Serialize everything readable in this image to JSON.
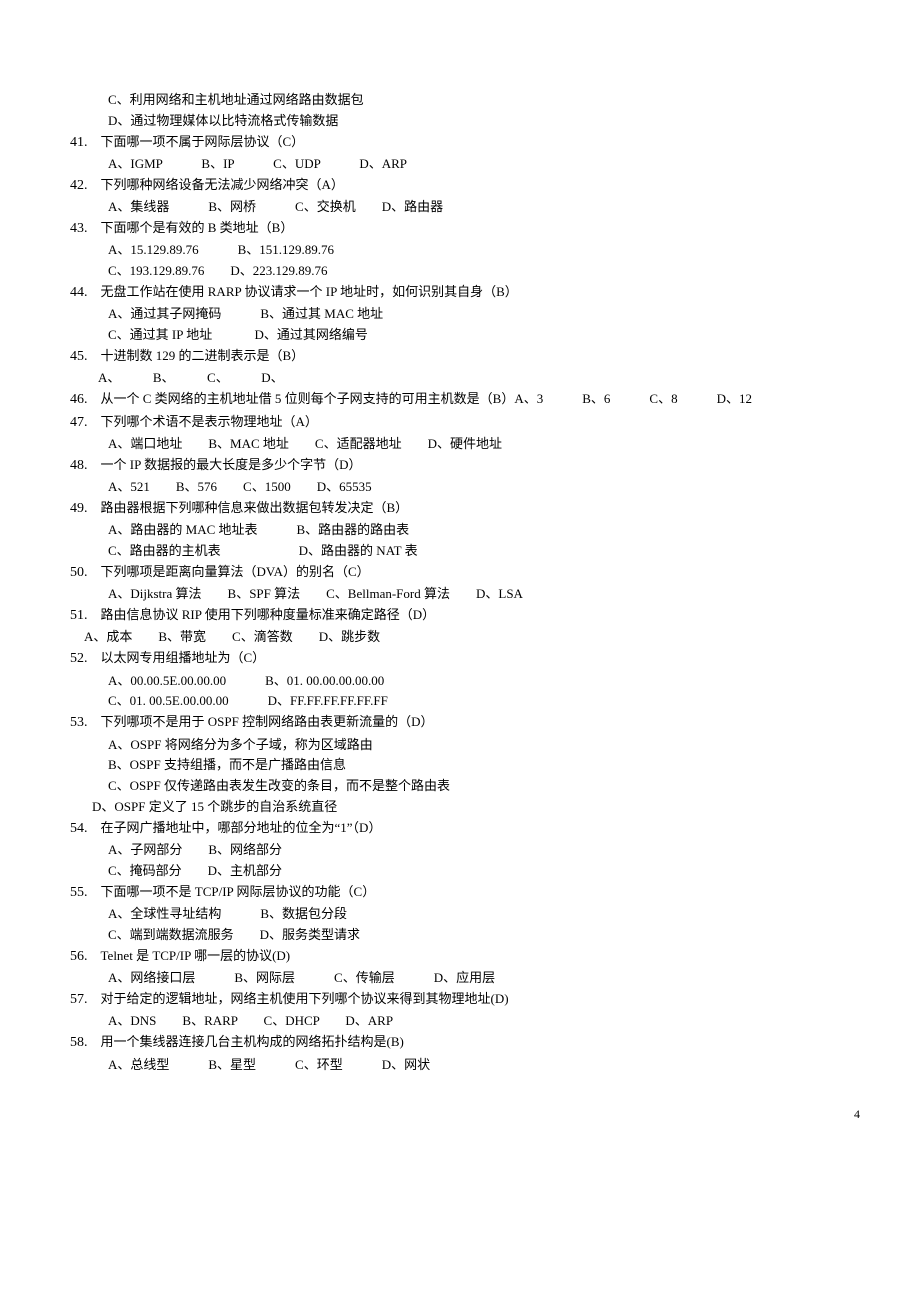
{
  "page_number": "4",
  "pre_options": {
    "c": "C、利用网络和主机地址通过网络路由数据包",
    "d": "D、通过物理媒体以比特流格式传输数据"
  },
  "q41": {
    "num": "41.",
    "text": "下面哪一项不属于网际层协议（C）",
    "opts": "A、IGMP　　　B、IP　　　C、UDP　　　D、ARP"
  },
  "q42": {
    "num": "42.",
    "text": "下列哪种网络设备无法减少网络冲突（A）",
    "opts": "A、集线器　　　B、网桥　　　C、交换机　　D、路由器"
  },
  "q43": {
    "num": "43.",
    "text": "下面哪个是有效的 B 类地址（B）",
    "line1": "A、15.129.89.76　　　B、151.129.89.76",
    "line2": "C、193.129.89.76　　D、223.129.89.76"
  },
  "q44": {
    "num": "44.",
    "text": "无盘工作站在使用 RARP 协议请求一个 IP 地址时，如何识别其自身（B）",
    "line1": "A、通过其子网掩码　　　B、通过其 MAC 地址",
    "line2": "C、通过其 IP 地址　　　 D、通过其网络编号"
  },
  "q45": {
    "num": "45.",
    "text": "十进制数 129 的二进制表示是（B）",
    "opts": "A、　　　B、　　　C、　　　D、"
  },
  "q46": {
    "num": "46.",
    "text": "从一个 C 类网络的主机地址借 5 位则每个子网支持的可用主机数是（B）A、3　　　B、6　　　C、8　　　D、12"
  },
  "q47": {
    "num": "47.",
    "text": "下列哪个术语不是表示物理地址（A）",
    "opts": "A、端口地址　　B、MAC 地址　　C、适配器地址　　D、硬件地址"
  },
  "q48": {
    "num": "48.",
    "text": "一个 IP 数据报的最大长度是多少个字节（D）",
    "opts": "A、521　　B、576　　C、1500　　D、65535"
  },
  "q49": {
    "num": "49.",
    "text": "路由器根据下列哪种信息来做出数据包转发决定（B）",
    "line1": "A、路由器的 MAC 地址表　　　B、路由器的路由表",
    "line2": "C、路由器的主机表　　　　　　D、路由器的 NAT 表"
  },
  "q50": {
    "num": "50.",
    "text": "下列哪项是距离向量算法（DVA）的别名（C）",
    "opts": "A、Dijkstra 算法　　B、SPF 算法　　C、Bellman-Ford 算法　　D、LSA"
  },
  "q51": {
    "num": "51.",
    "text": "路由信息协议 RIP 使用下列哪种度量标准来确定路径（D）",
    "opts": "A、成本　　B、带宽　　C、滴答数　　D、跳步数"
  },
  "q52": {
    "num": "52.",
    "text": "以太网专用组播地址为（C）",
    "line1": "A、00.00.5E.00.00.00　　　B、01. 00.00.00.00.00",
    "line2": "C、01. 00.5E.00.00.00　　　D、FF.FF.FF.FF.FF.FF"
  },
  "q53": {
    "num": "53.",
    "text": "下列哪项不是用于 OSPF 控制网络路由表更新流量的（D）",
    "a": "A、OSPF 将网络分为多个子域，称为区域路由",
    "b": "B、OSPF 支持组播，而不是广播路由信息",
    "c": "C、OSPF 仅传递路由表发生改变的条目，而不是整个路由表",
    "d": "D、OSPF 定义了 15 个跳步的自治系统直径"
  },
  "q54": {
    "num": "54.",
    "text": "在子网广播地址中，哪部分地址的位全为“1”（D）",
    "line1": "A、子网部分　　B、网络部分",
    "line2": "C、掩码部分　　D、主机部分"
  },
  "q55": {
    "num": "55.",
    "text": "下面哪一项不是 TCP/IP 网际层协议的功能（C）",
    "line1": "A、全球性寻址结构　　　B、数据包分段",
    "line2": "C、端到端数据流服务　　D、服务类型请求"
  },
  "q56": {
    "num": "56.",
    "text": "Telnet 是 TCP/IP 哪一层的协议(D)",
    "opts": "A、网络接口层　　　B、网际层　　　C、传输层　　　D、应用层"
  },
  "q57": {
    "num": "57.",
    "text": "对于给定的逻辑地址，网络主机使用下列哪个协议来得到其物理地址(D)",
    "opts": "A、DNS　　B、RARP　　C、DHCP　　D、ARP"
  },
  "q58": {
    "num": "58.",
    "text": "用一个集线器连接几台主机构成的网络拓扑结构是(B)",
    "opts": "A、总线型　　　B、星型　　　C、环型　　　D、网状"
  }
}
